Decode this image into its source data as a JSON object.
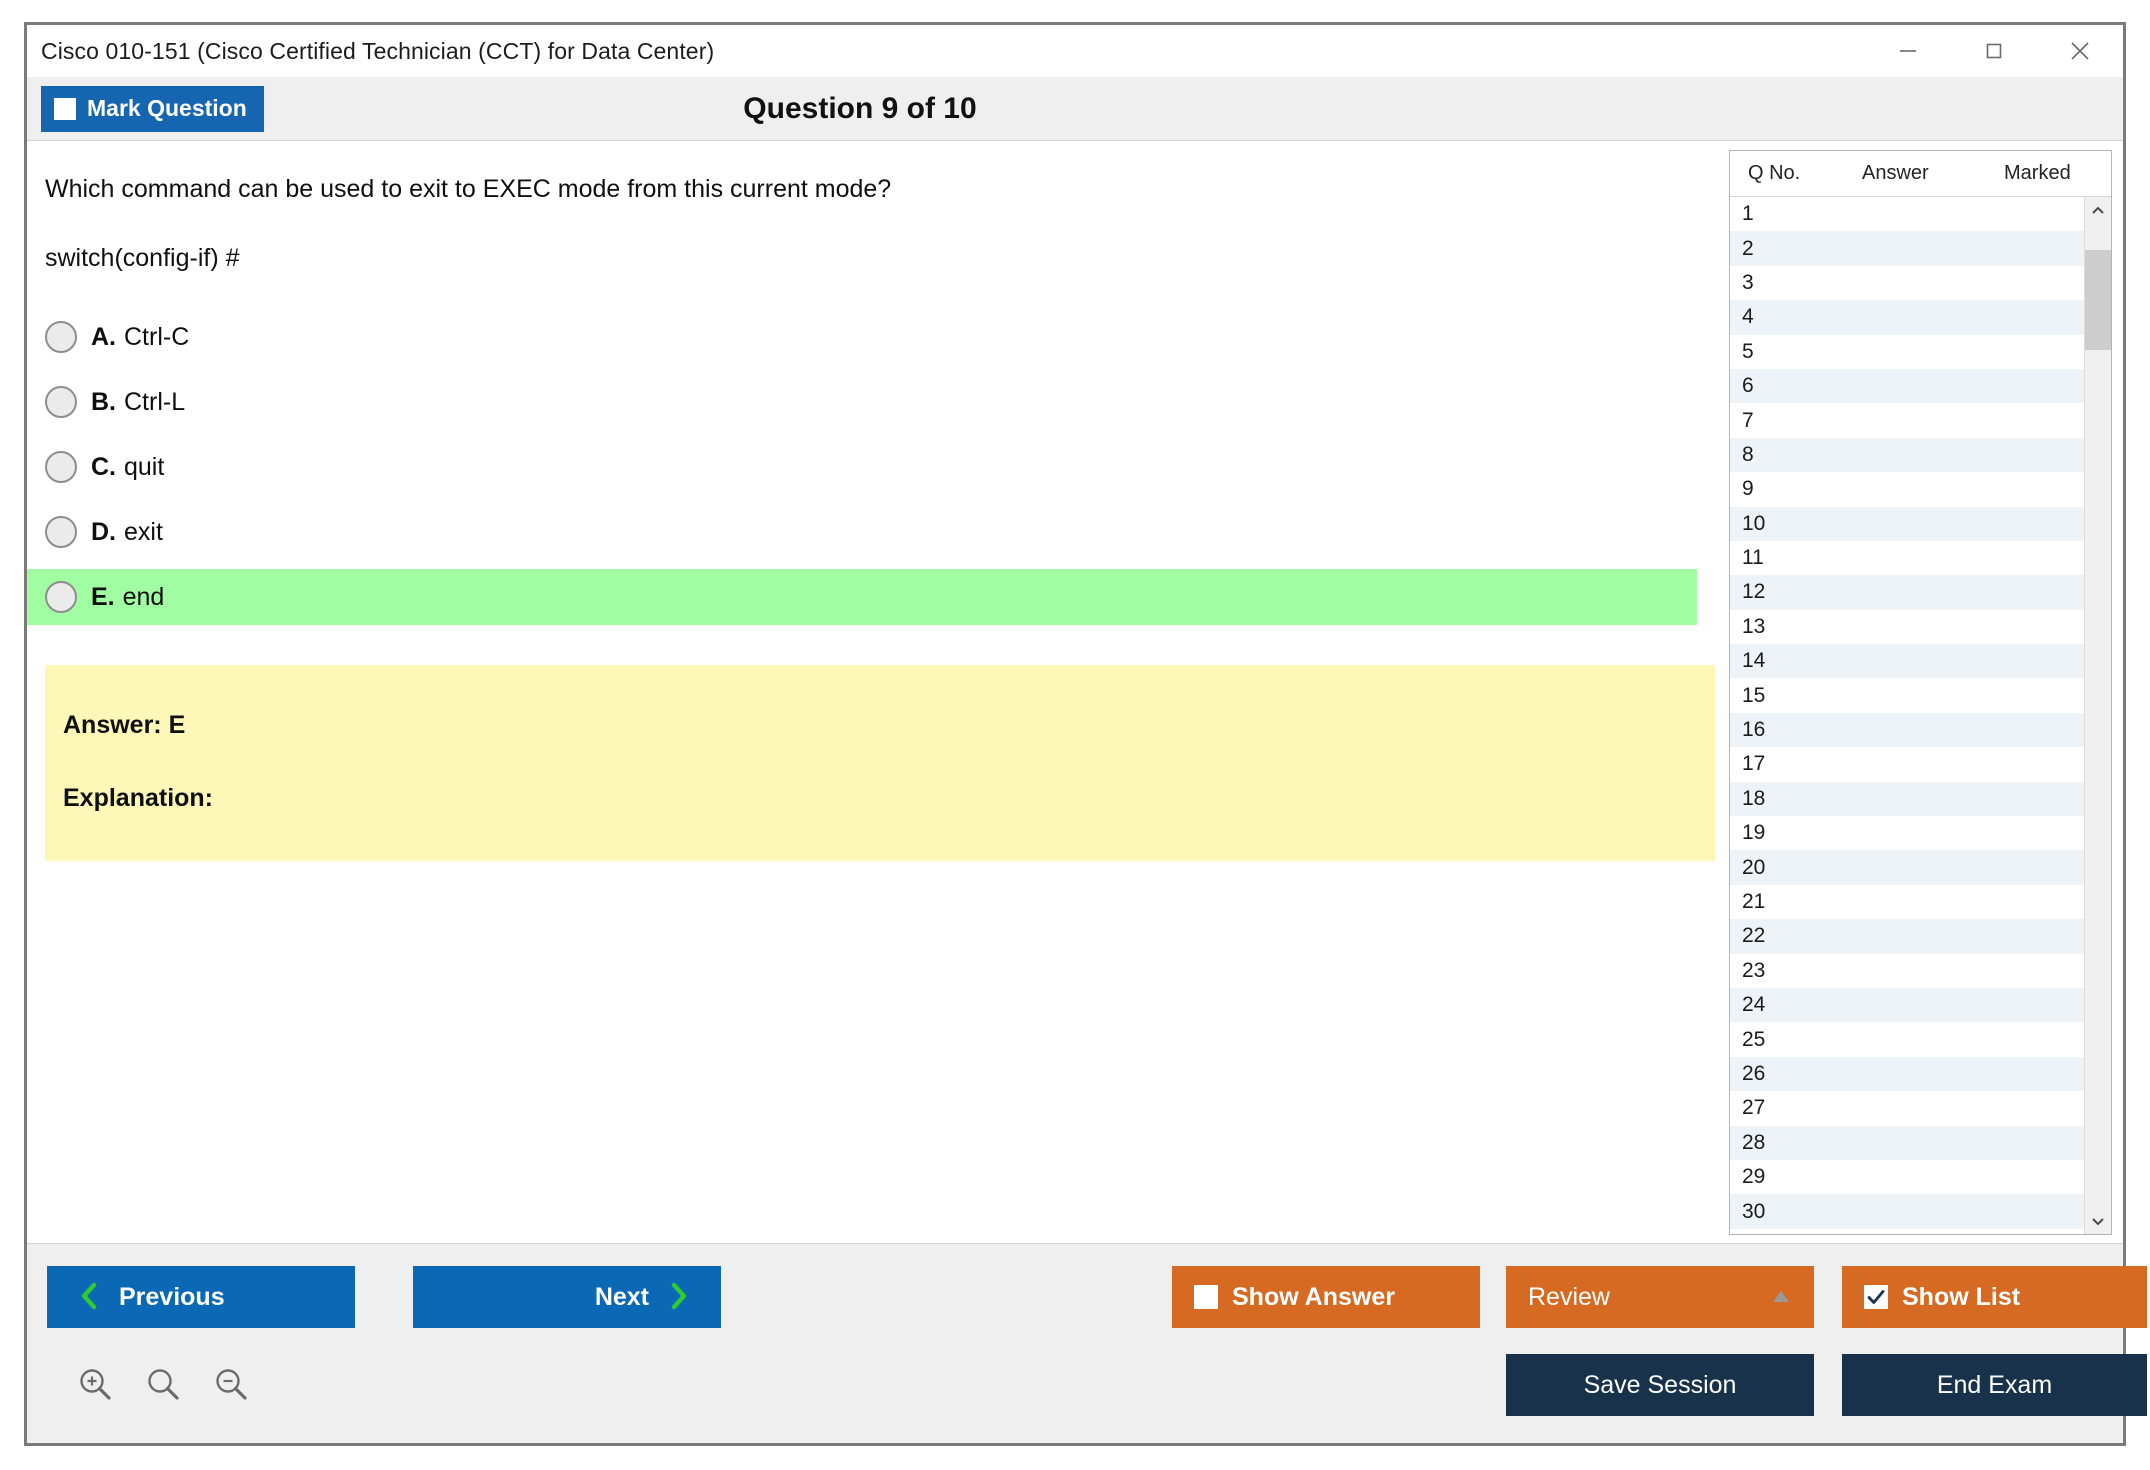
{
  "window": {
    "title": "Cisco 010-151 (Cisco Certified Technician (CCT) for Data Center)",
    "controls": {
      "minimize": "minimize-icon",
      "maximize": "maximize-icon",
      "close": "close-icon"
    }
  },
  "header": {
    "mark_question_label": "Mark Question",
    "mark_question_checked": false,
    "question_counter": "Question 9 of 10"
  },
  "question": {
    "text": "Which command can be used to exit to EXEC mode from this current mode?",
    "prompt": "switch(config-if) #",
    "choices": [
      {
        "letter": "A.",
        "text": "Ctrl-C",
        "selected": false,
        "correct": false
      },
      {
        "letter": "B.",
        "text": "Ctrl-L",
        "selected": false,
        "correct": false
      },
      {
        "letter": "C.",
        "text": "quit",
        "selected": false,
        "correct": false
      },
      {
        "letter": "D.",
        "text": "exit",
        "selected": false,
        "correct": false
      },
      {
        "letter": "E.",
        "text": "end",
        "selected": false,
        "correct": true
      }
    ],
    "answer_line": "Answer: E",
    "explanation_line": "Explanation:"
  },
  "side_list": {
    "columns": [
      "Q No.",
      "Answer",
      "Marked"
    ],
    "rows": [
      {
        "no": "1",
        "answer": "",
        "marked": ""
      },
      {
        "no": "2",
        "answer": "",
        "marked": ""
      },
      {
        "no": "3",
        "answer": "",
        "marked": ""
      },
      {
        "no": "4",
        "answer": "",
        "marked": ""
      },
      {
        "no": "5",
        "answer": "",
        "marked": ""
      },
      {
        "no": "6",
        "answer": "",
        "marked": ""
      },
      {
        "no": "7",
        "answer": "",
        "marked": ""
      },
      {
        "no": "8",
        "answer": "",
        "marked": ""
      },
      {
        "no": "9",
        "answer": "",
        "marked": ""
      },
      {
        "no": "10",
        "answer": "",
        "marked": ""
      },
      {
        "no": "11",
        "answer": "",
        "marked": ""
      },
      {
        "no": "12",
        "answer": "",
        "marked": ""
      },
      {
        "no": "13",
        "answer": "",
        "marked": ""
      },
      {
        "no": "14",
        "answer": "",
        "marked": ""
      },
      {
        "no": "15",
        "answer": "",
        "marked": ""
      },
      {
        "no": "16",
        "answer": "",
        "marked": ""
      },
      {
        "no": "17",
        "answer": "",
        "marked": ""
      },
      {
        "no": "18",
        "answer": "",
        "marked": ""
      },
      {
        "no": "19",
        "answer": "",
        "marked": ""
      },
      {
        "no": "20",
        "answer": "",
        "marked": ""
      },
      {
        "no": "21",
        "answer": "",
        "marked": ""
      },
      {
        "no": "22",
        "answer": "",
        "marked": ""
      },
      {
        "no": "23",
        "answer": "",
        "marked": ""
      },
      {
        "no": "24",
        "answer": "",
        "marked": ""
      },
      {
        "no": "25",
        "answer": "",
        "marked": ""
      },
      {
        "no": "26",
        "answer": "",
        "marked": ""
      },
      {
        "no": "27",
        "answer": "",
        "marked": ""
      },
      {
        "no": "28",
        "answer": "",
        "marked": ""
      },
      {
        "no": "29",
        "answer": "",
        "marked": ""
      },
      {
        "no": "30",
        "answer": "",
        "marked": ""
      }
    ]
  },
  "footer": {
    "previous_label": "Previous",
    "next_label": "Next",
    "show_answer_label": "Show Answer",
    "show_answer_checked": false,
    "review_label": "Review",
    "show_list_label": "Show List",
    "show_list_checked": true,
    "save_session_label": "Save Session",
    "end_exam_label": "End Exam",
    "zoom_icons": [
      "zoom-in-icon",
      "zoom-reset-icon",
      "zoom-out-icon"
    ]
  },
  "colors": {
    "primary_blue": "#0b68b4",
    "mark_blue": "#1565b0",
    "orange": "#d66a22",
    "navy": "#17324a",
    "correct_green": "#a1fda1",
    "answer_yellow": "#fdf8b8",
    "chrome_gray": "#efeff0",
    "chevron_green": "#2fcb2f"
  }
}
